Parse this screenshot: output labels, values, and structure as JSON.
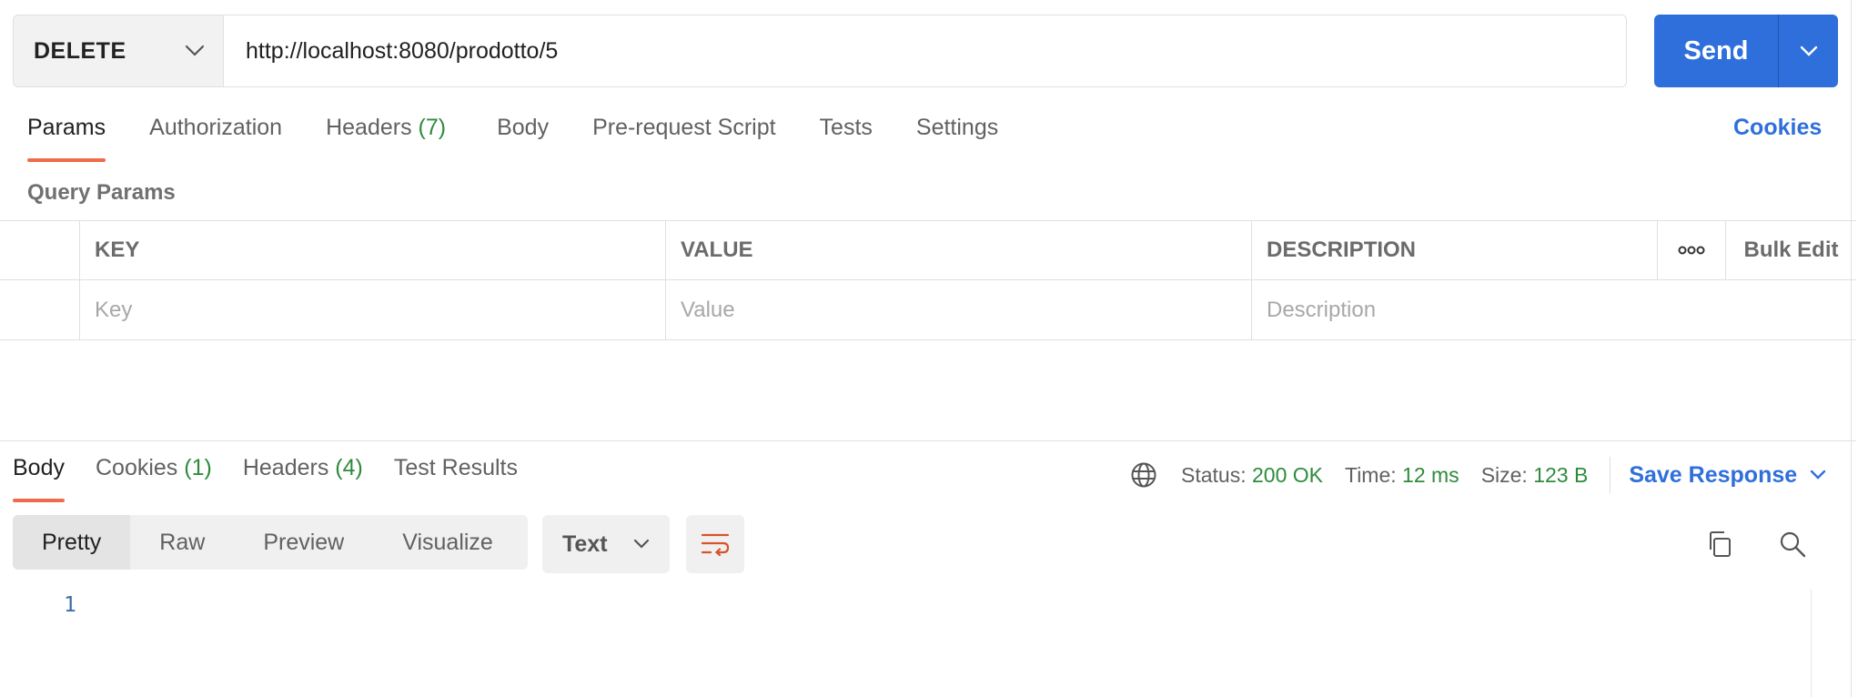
{
  "request": {
    "method": "DELETE",
    "url": "http://localhost:8080/prodotto/5",
    "send_label": "Send"
  },
  "request_tabs": [
    {
      "label": "Params",
      "count": "",
      "active": true
    },
    {
      "label": "Authorization",
      "count": ""
    },
    {
      "label": "Headers",
      "count": "(7)"
    },
    {
      "label": "Body",
      "count": ""
    },
    {
      "label": "Pre-request Script",
      "count": ""
    },
    {
      "label": "Tests",
      "count": ""
    },
    {
      "label": "Settings",
      "count": ""
    }
  ],
  "cookies_link": "Cookies",
  "query_params": {
    "title": "Query Params",
    "columns": {
      "key": "KEY",
      "value": "VALUE",
      "description": "DESCRIPTION"
    },
    "more_icon": "ellipsis-icon",
    "bulk_edit": "Bulk Edit",
    "placeholders": {
      "key": "Key",
      "value": "Value",
      "description": "Description"
    }
  },
  "response_tabs": [
    {
      "label": "Body",
      "count": "",
      "active": true
    },
    {
      "label": "Cookies",
      "count": "(1)"
    },
    {
      "label": "Headers",
      "count": "(4)"
    },
    {
      "label": "Test Results",
      "count": ""
    }
  ],
  "response_meta": {
    "status_label": "Status:",
    "status_value": "200 OK",
    "time_label": "Time:",
    "time_value": "12 ms",
    "size_label": "Size:",
    "size_value": "123 B",
    "save_response": "Save Response"
  },
  "body_view": {
    "modes": [
      "Pretty",
      "Raw",
      "Preview",
      "Visualize"
    ],
    "active_mode": "Pretty",
    "format": "Text",
    "line_numbers": [
      "1"
    ]
  },
  "colors": {
    "accent": "#2f6fdb",
    "tab_indicator": "#ef6c4a",
    "status_ok": "#2e8b3c"
  }
}
